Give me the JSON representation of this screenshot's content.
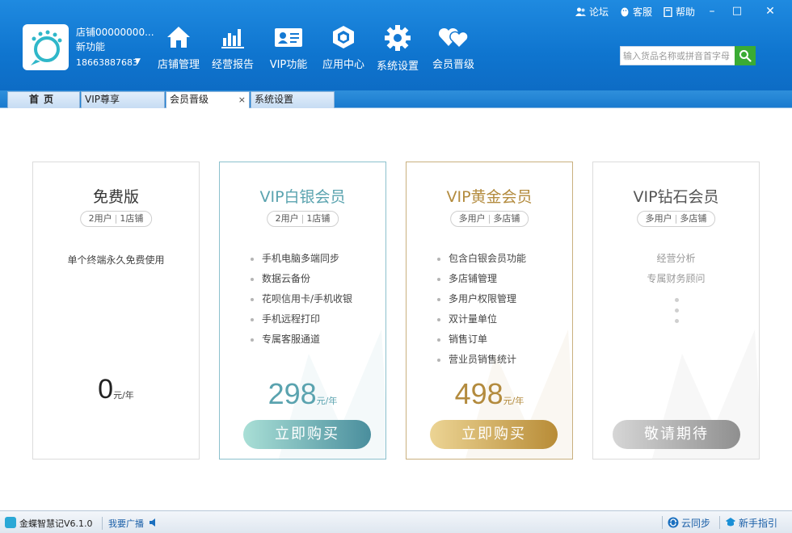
{
  "header": {
    "shop_name": "店铺00000000...",
    "shop_sub": "新功能",
    "phone": "18663887683",
    "nav": [
      {
        "label": "店铺管理",
        "icon": "home-icon"
      },
      {
        "label": "经营报告",
        "icon": "bar-chart-icon"
      },
      {
        "label": "VIP功能",
        "icon": "vip-card-icon"
      },
      {
        "label": "应用中心",
        "icon": "app-center-icon"
      },
      {
        "label": "系统设置",
        "icon": "gear-icon"
      },
      {
        "label": "会员晋级",
        "icon": "hearts-icon"
      }
    ],
    "links": [
      {
        "label": "论坛",
        "icon": "users-icon"
      },
      {
        "label": "客服",
        "icon": "penguin-icon"
      },
      {
        "label": "帮助",
        "icon": "book-icon"
      }
    ],
    "window_controls": [
      "–",
      "□",
      "✕"
    ],
    "search_placeholder": "输入货品名称或拼音首字母"
  },
  "tabs": [
    {
      "label": "首页"
    },
    {
      "label": "VIP尊享"
    },
    {
      "label": "会员晋级",
      "active": true,
      "close": "×"
    },
    {
      "label": "系统设置"
    }
  ],
  "plans": [
    {
      "title": "免费版",
      "users": "2用户",
      "shops": "1店铺",
      "desc": "单个终端永久免费使用",
      "price": "0",
      "unit": "元/年"
    },
    {
      "title": "VIP白银会员",
      "users": "2用户",
      "shops": "1店铺",
      "features": [
        "手机电脑多端同步",
        "数据云备份",
        "花呗信用卡/手机收银",
        "手机远程打印",
        "专属客服通道"
      ],
      "price": "298",
      "unit": "元/年",
      "button": "立即购买"
    },
    {
      "title": "VIP黄金会员",
      "users": "多用户",
      "shops": "多店铺",
      "features": [
        "包含白银会员功能",
        "多店铺管理",
        "多用户权限管理",
        "双计量单位",
        "销售订单",
        "营业员销售统计"
      ],
      "price": "498",
      "unit": "元/年",
      "button": "立即购买"
    },
    {
      "title": "VIP钻石会员",
      "users": "多用户",
      "shops": "多店铺",
      "features": [
        "经营分析",
        "专属财务顾问"
      ],
      "button": "敬请期待"
    }
  ],
  "status": {
    "version": "金蝶智慧记V6.1.0",
    "broadcast": "我要广播",
    "sync": "云同步",
    "guide": "新手指引"
  }
}
